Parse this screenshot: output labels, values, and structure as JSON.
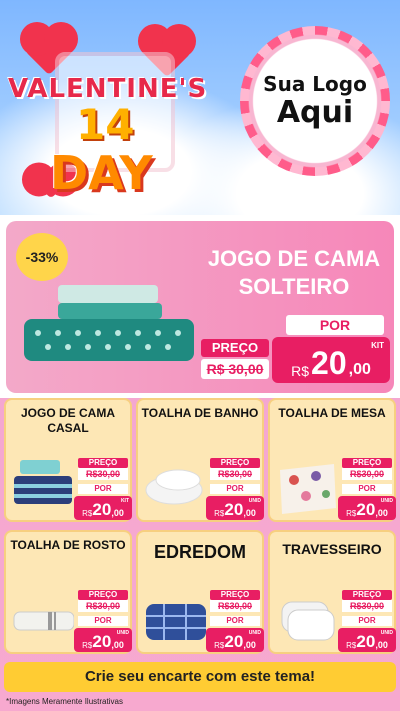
{
  "header": {
    "title_line1": "VALENTINE'S",
    "title_line2": "14",
    "title_line3": "DAY",
    "logo_line1": "Sua Logo",
    "logo_line2": "Aqui"
  },
  "featured": {
    "discount": "-33%",
    "title": "JOGO DE CAMA SOLTEIRO",
    "preco_label": "PREÇO",
    "old_price": "R$ 30,00",
    "por_label": "POR",
    "currency": "R$",
    "price_int": "20",
    "price_cents": ",00",
    "unit": "KIT"
  },
  "products": [
    {
      "title": "JOGO DE CAMA CASAL",
      "preco_label": "PREÇO",
      "old_price": "R$30,00",
      "por_label": "POR",
      "currency": "R$",
      "price_int": "20",
      "price_cents": ",00",
      "unit": "KIT"
    },
    {
      "title": "TOALHA DE BANHO",
      "preco_label": "PREÇO",
      "old_price": "R$30,00",
      "por_label": "POR",
      "currency": "R$",
      "price_int": "20",
      "price_cents": ",00",
      "unit": "UNID"
    },
    {
      "title": "TOALHA DE MESA",
      "preco_label": "PREÇO",
      "old_price": "R$30,00",
      "por_label": "POR",
      "currency": "R$",
      "price_int": "20",
      "price_cents": ",00",
      "unit": "UNID"
    },
    {
      "title": "TOALHA DE ROSTO",
      "preco_label": "PREÇO",
      "old_price": "R$30,00",
      "por_label": "POR",
      "currency": "R$",
      "price_int": "20",
      "price_cents": ",00",
      "unit": "UNID"
    },
    {
      "title": "EDREDOM",
      "preco_label": "PREÇO",
      "old_price": "R$30,00",
      "por_label": "POR",
      "currency": "R$",
      "price_int": "20",
      "price_cents": ",00",
      "unit": "UNID"
    },
    {
      "title": "TRAVESSEIRO",
      "preco_label": "PREÇO",
      "old_price": "R$30,00",
      "por_label": "POR",
      "currency": "R$",
      "price_int": "20",
      "price_cents": ",00",
      "unit": "UNID"
    }
  ],
  "cta": "Crie seu encarte com este tema!",
  "footnote": "*Imagens Meramente Ilustrativas",
  "colors": {
    "accent": "#e81e63",
    "card_bg": "#fde7b5",
    "cta_bg": "#ffcc33",
    "pink_bg": "#f687b9"
  }
}
